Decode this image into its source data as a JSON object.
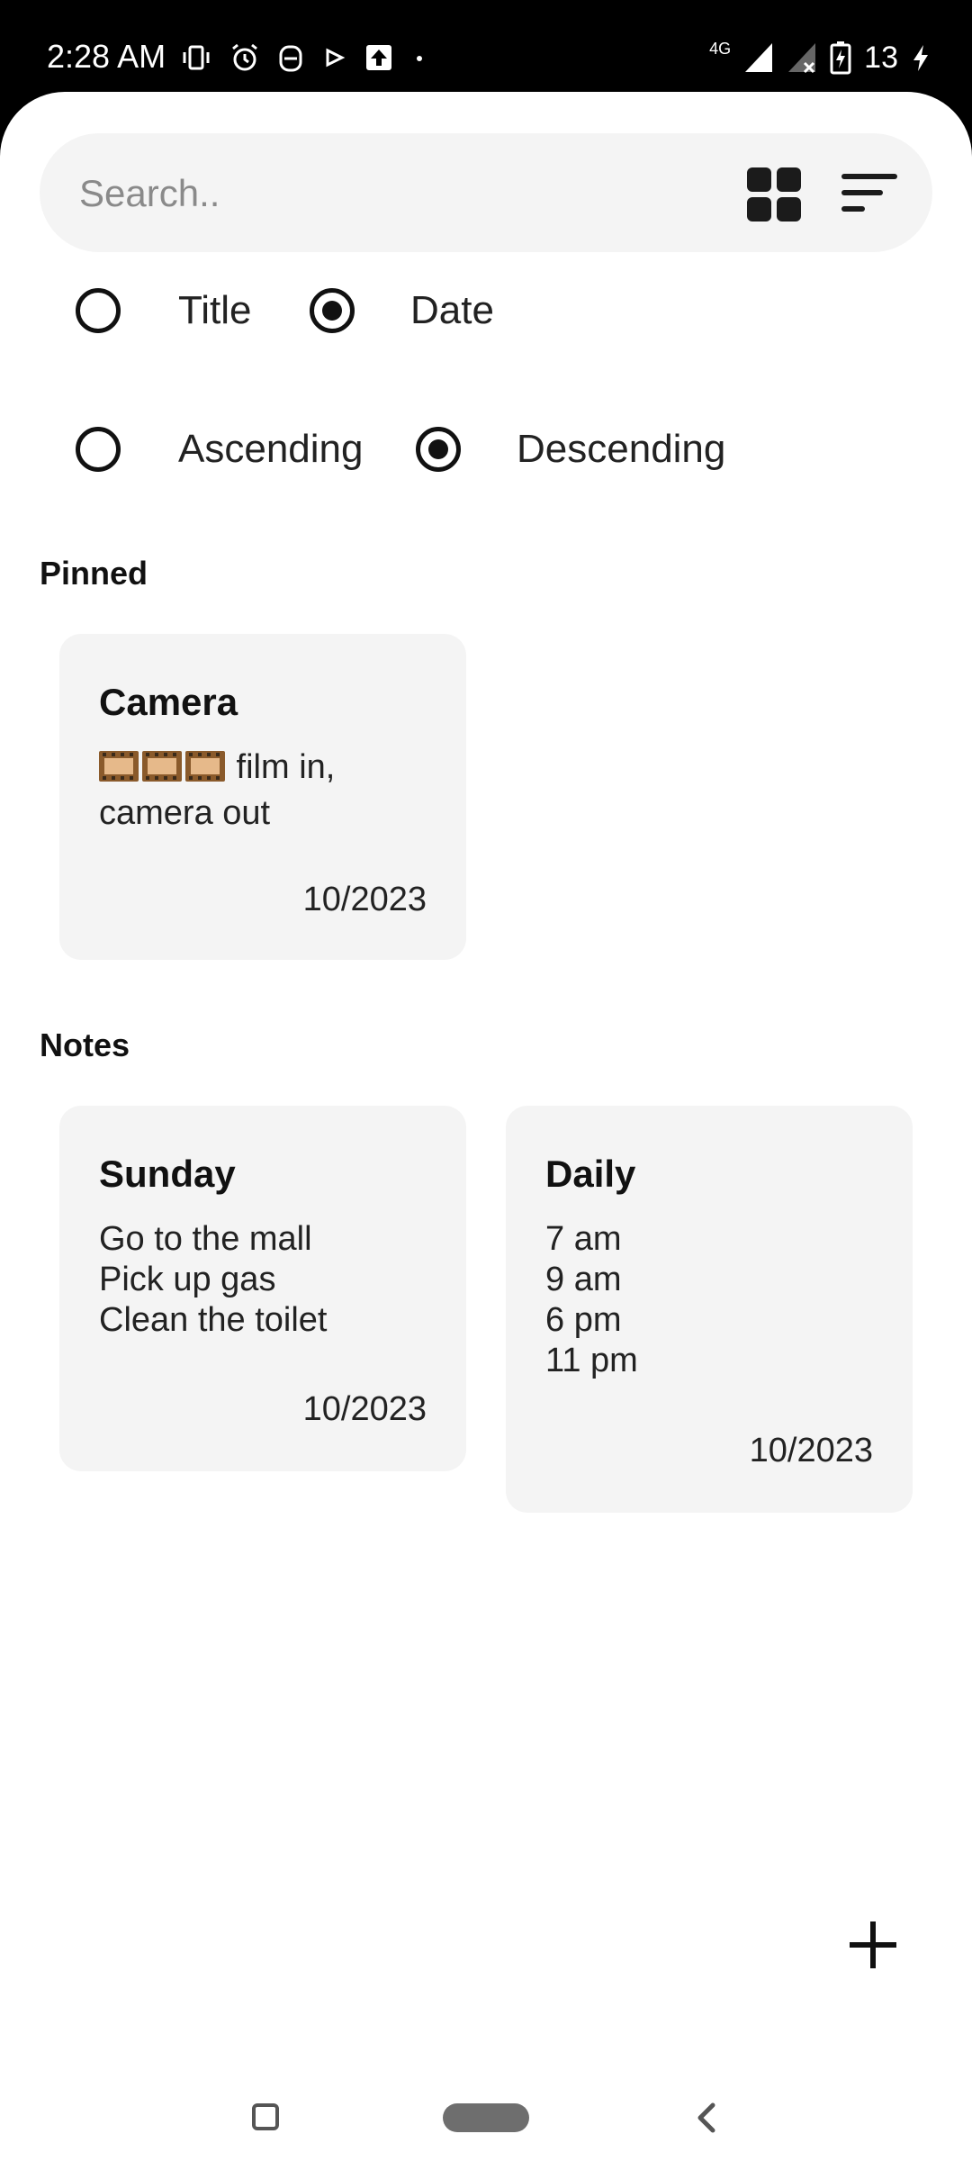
{
  "status_bar": {
    "time": "2:28 AM",
    "network_label": "4G",
    "battery_level": "13",
    "icons": [
      "vibrate-icon",
      "alarm-icon",
      "app-notification-icon",
      "play-icon",
      "upload-icon",
      "dot-icon",
      "signal-icon",
      "signal-no-service-icon",
      "battery-charging-icon",
      "charging-bolt-icon"
    ]
  },
  "search": {
    "placeholder": "Search..",
    "value": ""
  },
  "sort": {
    "field_options": [
      {
        "label": "Title",
        "selected": false
      },
      {
        "label": "Date",
        "selected": true
      }
    ],
    "order_options": [
      {
        "label": "Ascending",
        "selected": false
      },
      {
        "label": "Descending",
        "selected": true
      }
    ]
  },
  "sections": {
    "pinned_title": "Pinned",
    "notes_title": "Notes"
  },
  "pinned_notes": [
    {
      "title": "Camera",
      "body_prefix_icon": "film-strip-emoji",
      "body": " film in,\ncamera out",
      "date": "10/2023"
    }
  ],
  "notes": [
    {
      "title": "Sunday",
      "body": "Go to the mall\nPick up gas\nClean the toilet",
      "date": "10/2023"
    },
    {
      "title": "Daily",
      "body": "7 am\n9 am\n6 pm\n11 pm",
      "date": "10/2023"
    }
  ],
  "accent_color": "#111111",
  "card_color": "#f4f4f4"
}
